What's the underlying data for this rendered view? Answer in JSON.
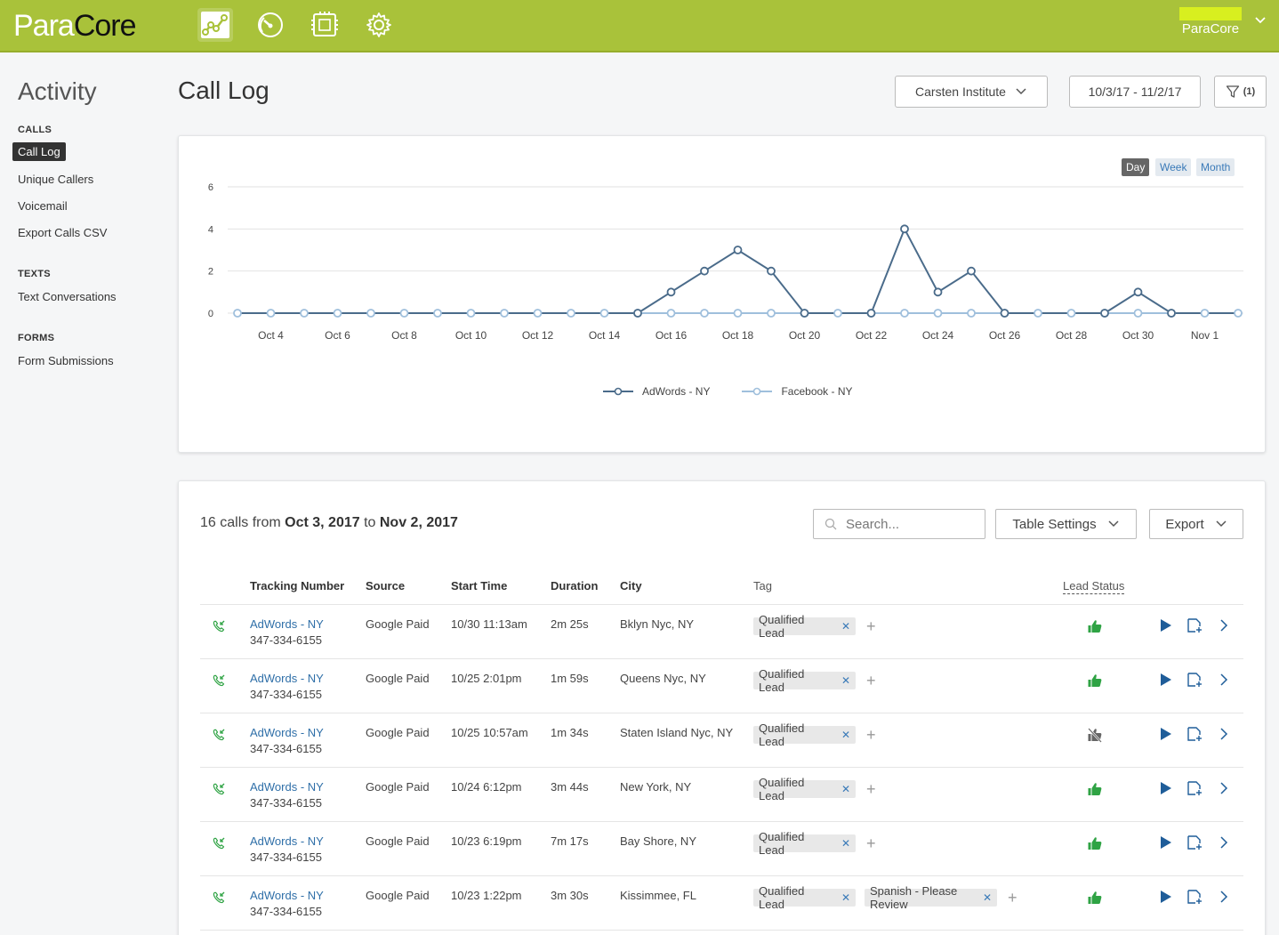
{
  "brand": {
    "logo_left": "Para",
    "logo_right": "Core"
  },
  "topnav": {
    "items": [
      "analytics-icon",
      "speedometer-icon",
      "processor-icon",
      "gear-icon"
    ],
    "user_name": "ParaCore"
  },
  "sidebar": {
    "title": "Activity",
    "sections": [
      {
        "label": "CALLS",
        "items": [
          "Call Log",
          "Unique Callers",
          "Voicemail",
          "Export Calls CSV"
        ]
      },
      {
        "label": "TEXTS",
        "items": [
          "Text Conversations"
        ]
      },
      {
        "label": "FORMS",
        "items": [
          "Form Submissions"
        ]
      }
    ],
    "active_item": "Call Log"
  },
  "header": {
    "title": "Call Log",
    "account": "Carsten Institute",
    "date_range": "10/3/17 - 11/2/17",
    "filter_count": "(1)"
  },
  "range_buttons": {
    "day": "Day",
    "week": "Week",
    "month": "Month",
    "active": "Day"
  },
  "colors": {
    "brand": "#a9c23a",
    "series_adwords": "#4a6b8a",
    "series_facebook": "#9fbfdc",
    "link": "#2f6fa8",
    "thumb_green": "#2fa344"
  },
  "chart_data": {
    "type": "line",
    "x": [
      "Oct 3",
      "Oct 4",
      "Oct 5",
      "Oct 6",
      "Oct 7",
      "Oct 8",
      "Oct 9",
      "Oct 10",
      "Oct 11",
      "Oct 12",
      "Oct 13",
      "Oct 14",
      "Oct 15",
      "Oct 16",
      "Oct 17",
      "Oct 18",
      "Oct 19",
      "Oct 20",
      "Oct 21",
      "Oct 22",
      "Oct 23",
      "Oct 24",
      "Oct 25",
      "Oct 26",
      "Oct 27",
      "Oct 28",
      "Oct 29",
      "Oct 30",
      "Oct 31",
      "Nov 1",
      "Nov 2"
    ],
    "x_tick_labels": [
      "Oct 4",
      "Oct 6",
      "Oct 8",
      "Oct 10",
      "Oct 12",
      "Oct 14",
      "Oct 16",
      "Oct 18",
      "Oct 20",
      "Oct 22",
      "Oct 24",
      "Oct 26",
      "Oct 28",
      "Oct 30",
      "Nov 1"
    ],
    "y_ticks": [
      0,
      2,
      4,
      6
    ],
    "ylim": [
      0,
      6
    ],
    "grid": true,
    "legend_position": "bottom-center",
    "series": [
      {
        "name": "AdWords - NY",
        "values": [
          0,
          0,
          0,
          0,
          0,
          0,
          0,
          0,
          0,
          0,
          0,
          0,
          0,
          1,
          2,
          3,
          2,
          0,
          0,
          0,
          4,
          1,
          2,
          0,
          0,
          0,
          0,
          1,
          0,
          0,
          0
        ]
      },
      {
        "name": "Facebook - NY",
        "values": [
          0,
          0,
          0,
          0,
          0,
          0,
          0,
          0,
          0,
          0,
          0,
          0,
          0,
          0,
          0,
          0,
          0,
          0,
          0,
          0,
          0,
          0,
          0,
          0,
          0,
          0,
          0,
          0,
          0,
          0,
          0
        ]
      }
    ]
  },
  "table": {
    "summary_prefix": "16 calls from ",
    "summary_start": "Oct 3, 2017",
    "summary_mid": " to ",
    "summary_end": "Nov 2, 2017",
    "search_placeholder": "Search...",
    "table_settings_label": "Table Settings",
    "export_label": "Export",
    "columns": [
      "Tracking Number",
      "Source",
      "Start Time",
      "Duration",
      "City",
      "Tag",
      "Lead Status"
    ],
    "rows": [
      {
        "tracking": "AdWords - NY",
        "number": "347-334-6155",
        "source": "Google Paid",
        "start": "10/30 11:13am",
        "duration": "2m 25s",
        "city": "Bklyn Nyc, NY",
        "tags": [
          "Qualified Lead"
        ],
        "lead": "good"
      },
      {
        "tracking": "AdWords - NY",
        "number": "347-334-6155",
        "source": "Google Paid",
        "start": "10/25 2:01pm",
        "duration": "1m 59s",
        "city": "Queens Nyc, NY",
        "tags": [
          "Qualified Lead"
        ],
        "lead": "good"
      },
      {
        "tracking": "AdWords - NY",
        "number": "347-334-6155",
        "source": "Google Paid",
        "start": "10/25 10:57am",
        "duration": "1m 34s",
        "city": "Staten Island Nyc, NY",
        "tags": [
          "Qualified Lead"
        ],
        "lead": "not-rated"
      },
      {
        "tracking": "AdWords - NY",
        "number": "347-334-6155",
        "source": "Google Paid",
        "start": "10/24 6:12pm",
        "duration": "3m 44s",
        "city": "New York, NY",
        "tags": [
          "Qualified Lead"
        ],
        "lead": "good"
      },
      {
        "tracking": "AdWords - NY",
        "number": "347-334-6155",
        "source": "Google Paid",
        "start": "10/23 6:19pm",
        "duration": "7m 17s",
        "city": "Bay Shore, NY",
        "tags": [
          "Qualified Lead"
        ],
        "lead": "good"
      },
      {
        "tracking": "AdWords - NY",
        "number": "347-334-6155",
        "source": "Google Paid",
        "start": "10/23 1:22pm",
        "duration": "3m 30s",
        "city": "Kissimmee, FL",
        "tags": [
          "Qualified Lead",
          "Spanish - Please Review"
        ],
        "lead": "good"
      }
    ]
  }
}
